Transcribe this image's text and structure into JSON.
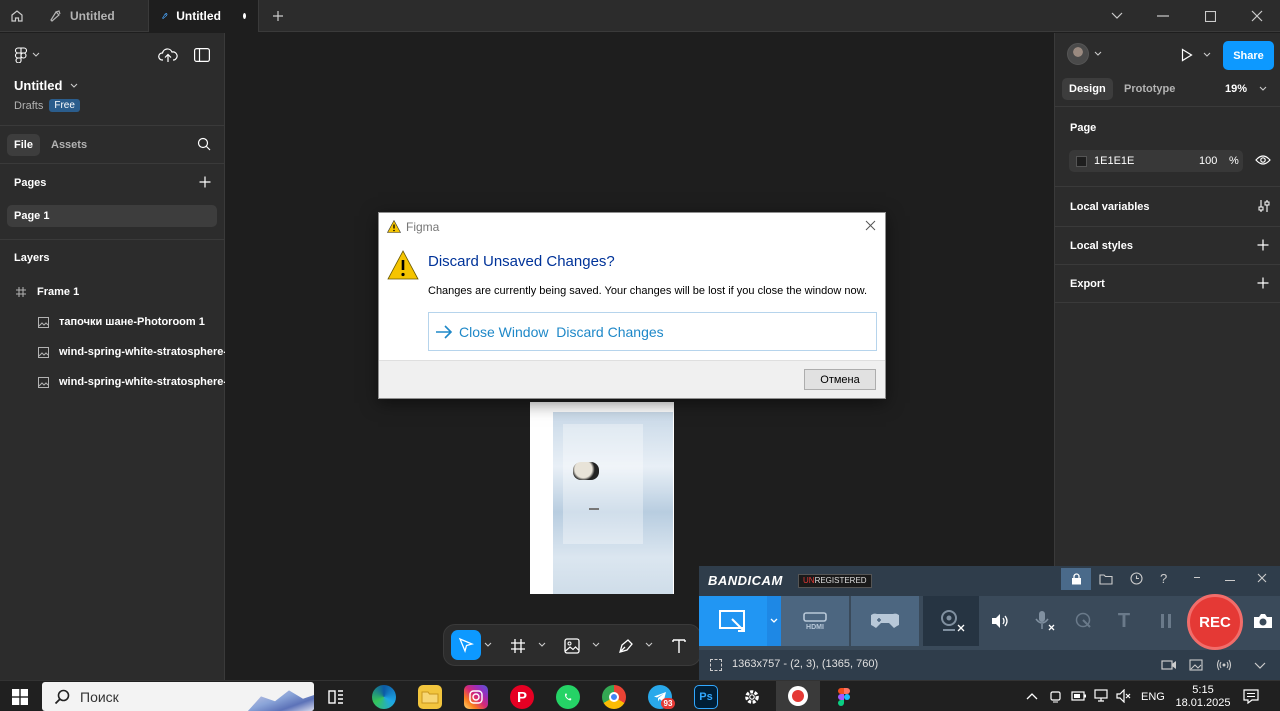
{
  "tabs": [
    {
      "label": "Untitled",
      "active": false
    },
    {
      "label": "Untitled",
      "active": true
    }
  ],
  "file": {
    "name": "Untitled",
    "location": "Drafts",
    "plan_badge": "Free"
  },
  "left_tabs": {
    "file": "File",
    "assets": "Assets"
  },
  "pages": {
    "heading": "Pages",
    "items": [
      "Page 1"
    ]
  },
  "layers": {
    "heading": "Layers",
    "items": [
      {
        "label": "Frame 1",
        "type": "frame"
      },
      {
        "label": "тапочки шане-Photoroom 1",
        "type": "image"
      },
      {
        "label": "wind-spring-white-stratosphere-p",
        "type": "image"
      },
      {
        "label": "wind-spring-white-stratosphere-p",
        "type": "image"
      }
    ]
  },
  "right": {
    "share_label": "Share",
    "tab_design": "Design",
    "tab_prototype": "Prototype",
    "zoom": "19%",
    "page_heading": "Page",
    "page_color": "1E1E1E",
    "page_opacity": "100",
    "percent_sign": "%",
    "local_variables": "Local variables",
    "local_styles": "Local styles",
    "export": "Export"
  },
  "dialog": {
    "app": "Figma",
    "title": "Discard Unsaved Changes?",
    "message": "Changes are currently being saved. Your changes will be lost if you close the window now.",
    "command_label": "Close Window  Discard Changes",
    "cancel_label": "Отмена"
  },
  "bandicam": {
    "brand": "BANDICAM",
    "unregistered_prefix": "UN",
    "unregistered_rest": "REGISTERED",
    "hdmi_label": "HDMI",
    "rec_label": "REC",
    "status": "1363x757 - (2, 3), (1365, 760)"
  },
  "taskbar": {
    "search_placeholder": "Поиск",
    "language": "ENG",
    "time": "5:15",
    "date": "18.01.2025",
    "telegram_badge": "93",
    "ps_label": "Ps"
  },
  "colors": {
    "accent": "#0d99ff",
    "panel_bg": "#2c2c2c",
    "canvas_bg": "#1e1e1e",
    "dialog_title": "#003399",
    "command_blue": "#1e88c8",
    "rec_red": "#e53935",
    "bandicam_bg": "#3a4a5a"
  }
}
